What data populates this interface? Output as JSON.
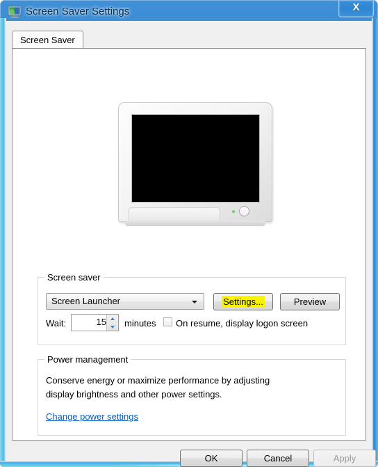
{
  "window": {
    "title": "Screen Saver Settings",
    "icon": "display-monitor-icon",
    "close_label": "X",
    "accent_color": "#2f86d2",
    "glass_edge_color": "#56c6e9",
    "dialog_background": "#f0f0f0"
  },
  "tabs": [
    {
      "label": "Screen Saver",
      "selected": true
    }
  ],
  "preview": {
    "monitor_screen_color": "#000000",
    "led_color": "#74c46a",
    "name": "screen-saver-preview-monitor"
  },
  "screen_saver_group": {
    "title": "Screen saver",
    "combo": {
      "value": "Screen Launcher",
      "options": [
        "Screen Launcher"
      ]
    },
    "settings_button": "Settings...",
    "settings_button_highlight_color": "#fbf400",
    "preview_button": "Preview",
    "wait_label": "Wait:",
    "wait_value": "15",
    "minutes_label": "minutes",
    "logon_checkbox_label": "On resume, display logon screen",
    "logon_checkbox_checked": false
  },
  "power_group": {
    "title": "Power management",
    "description_line1": "Conserve energy or maximize performance by adjusting",
    "description_line2": "display brightness and other power settings.",
    "link_label": "Change power settings",
    "link_color": "#0760c1"
  },
  "footer": {
    "ok_label": "OK",
    "cancel_label": "Cancel",
    "apply_label": "Apply",
    "apply_enabled": false
  }
}
